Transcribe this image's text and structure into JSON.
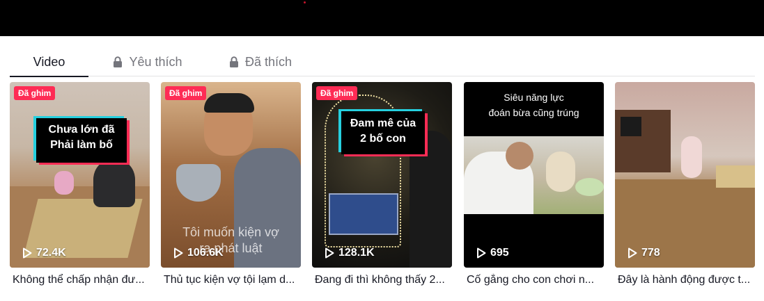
{
  "tabs": [
    {
      "label": "Video",
      "active": true
    },
    {
      "label": "Yêu thích",
      "locked": true
    },
    {
      "label": "Đã thích",
      "locked": true
    }
  ],
  "videos": [
    {
      "pinned": "Đã ghim",
      "overlay_line1": "Chưa lớn đã",
      "overlay_line2": "Phải làm bố",
      "plays": "72.4K",
      "title": "Không thể chấp nhận đư..."
    },
    {
      "pinned": "Đã ghim",
      "overlay_caption": "Tôi muốn kiện vợ",
      "overlay_caption2": "ra phát luật",
      "plays": "106.6K",
      "title": "Thủ tục kiện vợ tội lạm d..."
    },
    {
      "pinned": "Đã ghim",
      "overlay_line1": "Đam mê của",
      "overlay_line2": "2 bố con",
      "plays": "128.1K",
      "title": "Đang đi thì không thấy 2..."
    },
    {
      "overlay_line1": "Siêu năng lực",
      "overlay_line2": "đoán bừa cũng trúng",
      "plays": "695",
      "title": "Cố gắng cho con chơi n..."
    },
    {
      "plays": "778",
      "title": "Đây là hành động được t..."
    }
  ],
  "colors": {
    "accent": "#fe2c55",
    "text": "#161823",
    "muted": "#74757c"
  }
}
